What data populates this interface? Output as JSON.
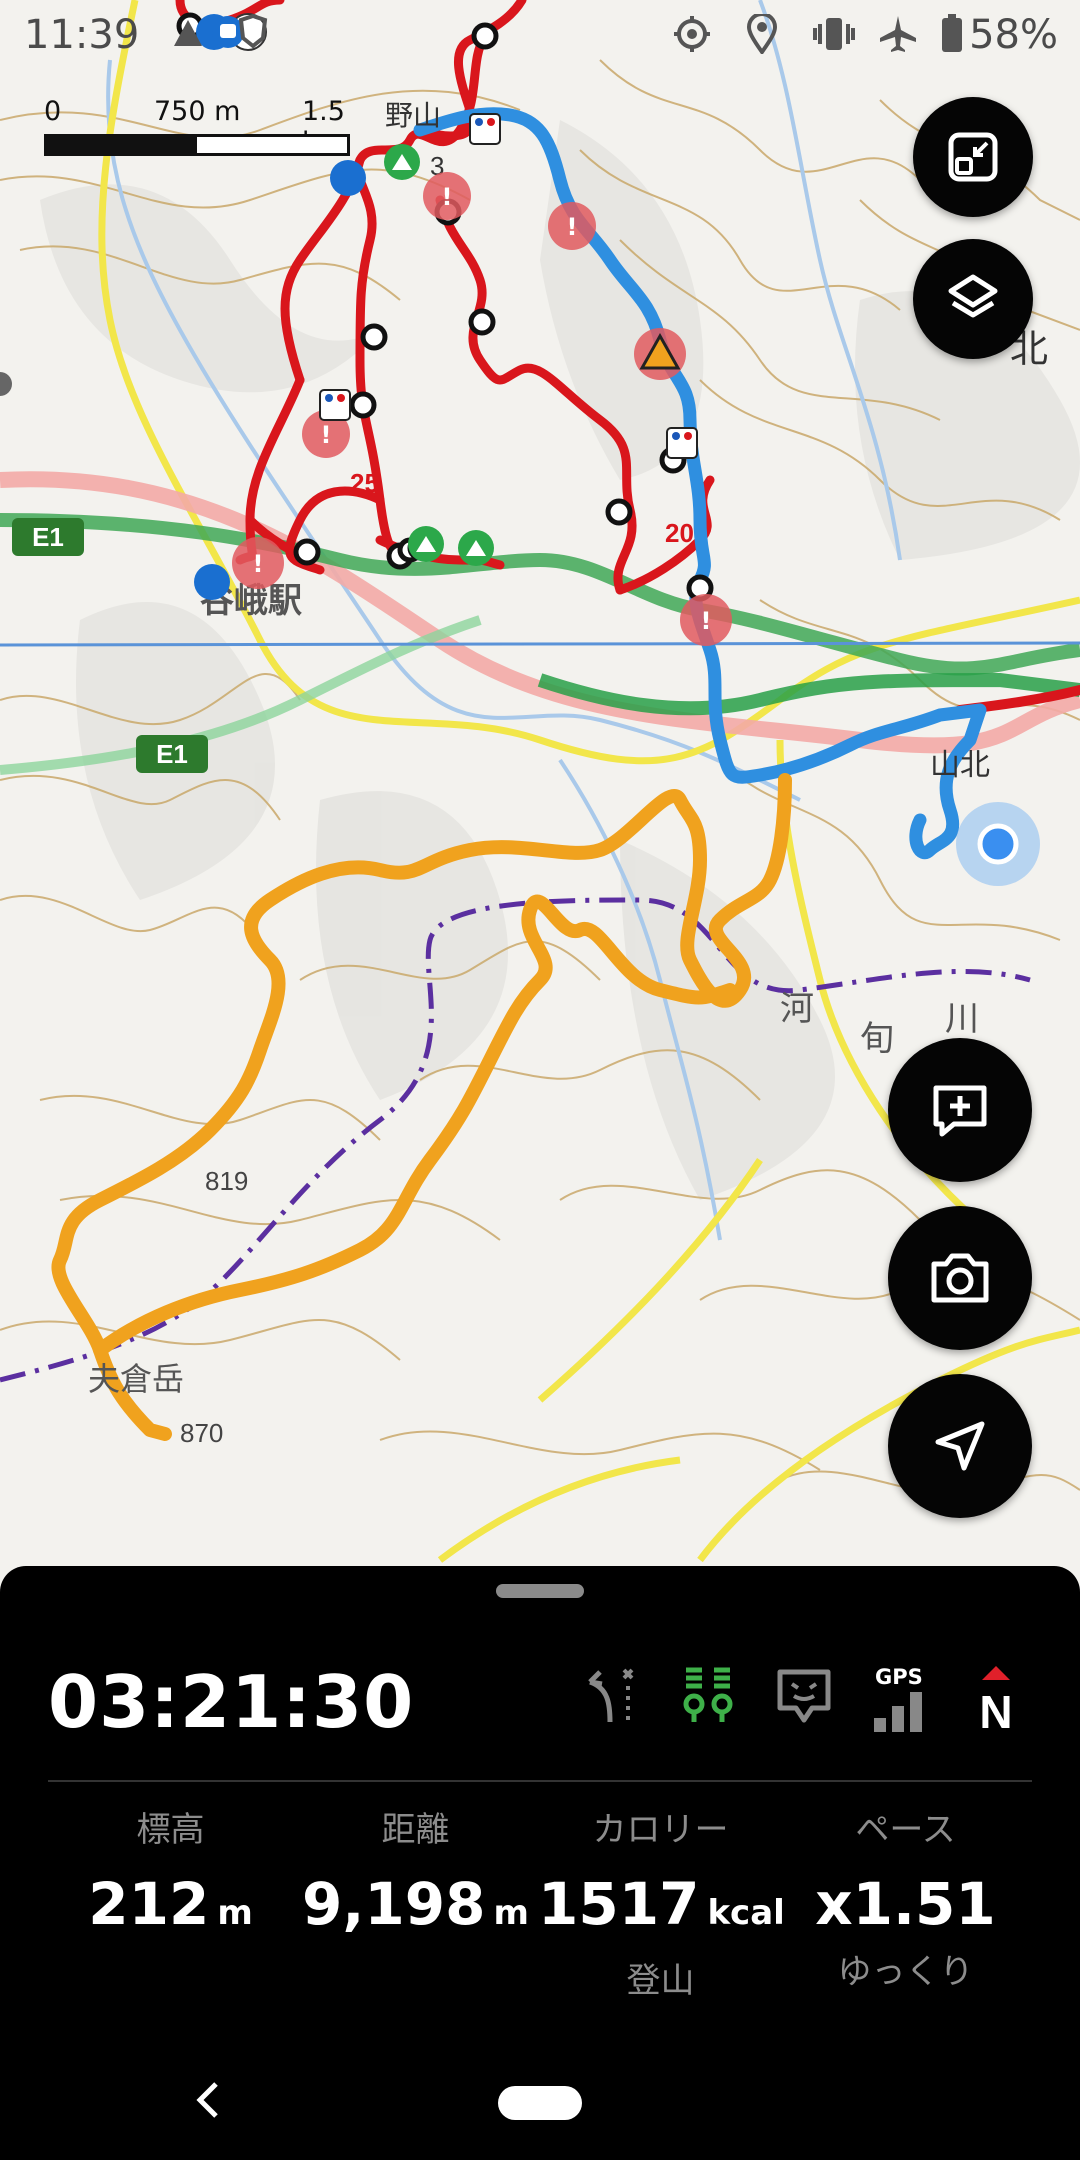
{
  "status_bar": {
    "time": "11:39",
    "battery": "58%",
    "icons": [
      "trail-icon",
      "bus-icon",
      "shield-icon",
      "location-crosshair-icon",
      "location-pin-icon",
      "vibrate-icon",
      "airplane-mode-icon",
      "battery-icon"
    ]
  },
  "map": {
    "scale": {
      "zero": "0",
      "mid": "750 m",
      "end": "1.5 km"
    },
    "labels": {
      "station": "谷峨駅",
      "route_e1_top": "E1",
      "route_e1_bottom": "E1",
      "elev_819": "819",
      "elev_870": "870",
      "peak_name": "夫倉岳",
      "river": "河",
      "river2": "旬",
      "river3": "川",
      "kita": "山北",
      "north_label": "北",
      "marker_25": "25",
      "marker_20": "20",
      "top_label": "野山",
      "top_num": "3"
    },
    "colors": {
      "red_trail": "#d9161c",
      "blue_trail": "#2f8fe0",
      "orange_track": "#f0a21e",
      "contour": "#c9a86a",
      "road_yellow": "#f2e64a"
    }
  },
  "buttons": {
    "minimize": "minimize-icon",
    "layers": "layers-icon",
    "add_note": "add-note-icon",
    "camera": "camera-icon",
    "navigate": "navigate-icon"
  },
  "panel": {
    "elapsed_time": "03:21:30",
    "gps_label": "GPS",
    "compass_label": "N",
    "stats": [
      {
        "label": "標高",
        "value": "212",
        "unit": "m",
        "sub": ""
      },
      {
        "label": "距離",
        "value": "9,198",
        "unit": "m",
        "sub": ""
      },
      {
        "label": "カロリー",
        "value": "1517",
        "unit": "kcal",
        "sub": "登山"
      },
      {
        "label": "ペース",
        "value": "x1.51",
        "unit": "",
        "sub": "ゆっくり"
      }
    ]
  }
}
